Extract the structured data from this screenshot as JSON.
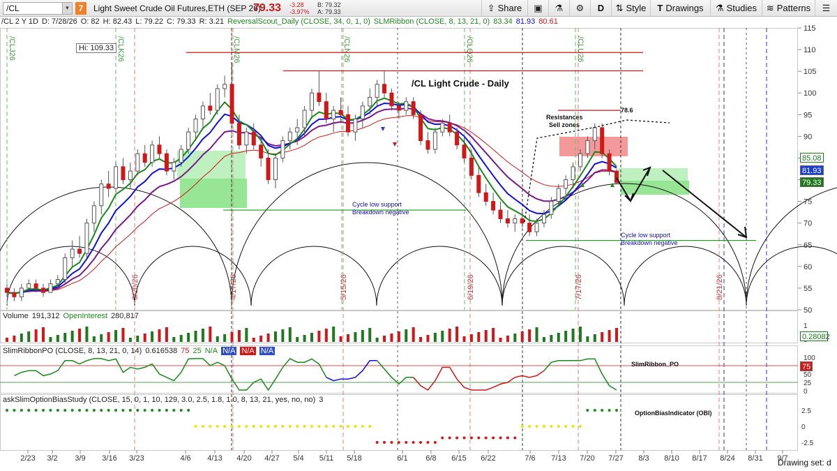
{
  "toolbar": {
    "symbol": "/CL",
    "badge": "7",
    "description": "Light Sweet Crude Oil Futures,ETH (SEP 26)",
    "last": "79.33",
    "change": "-3.28",
    "change_pct": "-3.97%",
    "bid": "B: 79.32",
    "ask": "A: 79.33",
    "share_label": "Share",
    "interval_label": "D",
    "style_label": "Style",
    "drawings_label": "Drawings",
    "studies_label": "Studies",
    "patterns_label": "Patterns"
  },
  "price_header": {
    "symbol": "/CL 2 Y 1D",
    "date": "D: 7/28/26",
    "open": "O: 82",
    "high": "H: 82.43",
    "low": "L: 79.22",
    "close": "C: 79.33",
    "range": "R: 3.21",
    "reversal_scout": "ReversalScout_Daily (CLOSE, 34, 0, 1, 0)",
    "slm_ribbon": "SLMRibbon (CLOSE, 8, 13, 21, 0)",
    "slm_v1": "83.34",
    "slm_v2": "81.93",
    "slm_v3": "80.61"
  },
  "chart_title": "/CL  Light Crude - Daily",
  "high_label": "Hi: 109.33",
  "annotations": {
    "resistance": "Resistances",
    "sell_zones": "Sell zones",
    "level": "78.6",
    "cycle_support_1a": "Cycle low support",
    "cycle_support_1b": "Breakdown negative",
    "cycle_support_2a": "Cycle low support",
    "cycle_support_2b": "Breakdown negative"
  },
  "price_badges": {
    "ema8": "85.08",
    "ema13": "81.93",
    "last": "79.33"
  },
  "volume_header": {
    "label": "Volume",
    "value": "191,312",
    "oi_label": "OpenInterest",
    "oi_value": "280,817",
    "badge": "0.28082"
  },
  "slimribbon_header": {
    "label": "SlimRibbonPO (CLOSE, 8, 13, 21, 0, 14)",
    "v1": "0.616538",
    "v2": "75",
    "v3": "25",
    "na1": "N/A",
    "na2": "N/A",
    "na3": "N/A",
    "na4": "N/A",
    "panel_label": "SlimRibbon_PO",
    "badge": "75"
  },
  "obi_header": {
    "label": "askSlimOptionBiasStudy (CLOSE, 15, 0, 1, 10, 129, 3.0, 2.5, 1.8, 1.0, 8, 13, 21, yes, no, no)",
    "v": "3",
    "panel_label": "OptionBiasIndicator (OBI)"
  },
  "status_bar": "Drawing set: d",
  "colors": {
    "up": "#1f7a1f",
    "down": "#d01818",
    "ema_blue": "#1010e0",
    "ema_green": "#1a8a1a",
    "ema_purple": "#7a1a8a",
    "support_zone": "#8be38b",
    "resist_zone": "#f08080",
    "dots_yellow": "#e8e800"
  },
  "chart_data": {
    "type": "candlestick",
    "price_axis": {
      "ylim": [
        50,
        115
      ],
      "ticks": [
        50,
        55,
        60,
        65,
        70,
        75,
        80,
        85,
        90,
        95,
        100,
        105,
        110,
        115
      ]
    },
    "x_ticks": [
      "2/23",
      "3/2",
      "3/9",
      "3/16",
      "3/23",
      "4/6",
      "4/13",
      "4/20",
      "4/27",
      "5/4",
      "5/11",
      "5/18",
      "6/1",
      "6/8",
      "6/15",
      "6/22",
      "7/6",
      "7/13",
      "7/20",
      "7/27",
      "8/3",
      "8/10",
      "8/17",
      "8/24",
      "8/31",
      "9/7"
    ],
    "cycle_dates": [
      "3/20/26",
      "4/17/26",
      "5/15/26",
      "6/19/26",
      "7/17/26",
      "8/21/26"
    ],
    "contract_labels": [
      "/CLJ26",
      "/CLK26",
      "/CLM26",
      "/CLN26",
      "/CLQ26",
      "/CLU26"
    ],
    "candles": [
      [
        55,
        56,
        53,
        54
      ],
      [
        54,
        55,
        52,
        53
      ],
      [
        53,
        56,
        52,
        55
      ],
      [
        55,
        57,
        54,
        56
      ],
      [
        56,
        57,
        54,
        55
      ],
      [
        55,
        56,
        53,
        54
      ],
      [
        54,
        57,
        54,
        56
      ],
      [
        56,
        58,
        55,
        57
      ],
      [
        57,
        63,
        56,
        62
      ],
      [
        62,
        66,
        60,
        64
      ],
      [
        64,
        67,
        62,
        63
      ],
      [
        63,
        71,
        62,
        70
      ],
      [
        70,
        75,
        68,
        74
      ],
      [
        74,
        80,
        72,
        79
      ],
      [
        79,
        82,
        76,
        78
      ],
      [
        78,
        84,
        77,
        83
      ],
      [
        83,
        85,
        79,
        80
      ],
      [
        80,
        84,
        78,
        82
      ],
      [
        82,
        87,
        81,
        86
      ],
      [
        86,
        88,
        83,
        84
      ],
      [
        84,
        89,
        83,
        88
      ],
      [
        88,
        90,
        85,
        86
      ],
      [
        86,
        87,
        81,
        82
      ],
      [
        82,
        85,
        80,
        84
      ],
      [
        84,
        88,
        83,
        87
      ],
      [
        87,
        92,
        86,
        91
      ],
      [
        91,
        95,
        89,
        94
      ],
      [
        94,
        98,
        92,
        97
      ],
      [
        97,
        100,
        95,
        96
      ],
      [
        96,
        102,
        95,
        101
      ],
      [
        101,
        104,
        99,
        102
      ],
      [
        102,
        107,
        92,
        93
      ],
      [
        93,
        95,
        87,
        88
      ],
      [
        88,
        92,
        86,
        91
      ],
      [
        91,
        93,
        87,
        88
      ],
      [
        88,
        90,
        83,
        85
      ],
      [
        85,
        87,
        79,
        80
      ],
      [
        80,
        86,
        78,
        85
      ],
      [
        85,
        90,
        84,
        89
      ],
      [
        89,
        92,
        87,
        91
      ],
      [
        91,
        94,
        88,
        92
      ],
      [
        92,
        97,
        90,
        96
      ],
      [
        96,
        101,
        94,
        100
      ],
      [
        100,
        105,
        97,
        98
      ],
      [
        98,
        100,
        93,
        94
      ],
      [
        94,
        97,
        91,
        96
      ],
      [
        96,
        99,
        93,
        95
      ],
      [
        95,
        97,
        90,
        91
      ],
      [
        91,
        95,
        89,
        94
      ],
      [
        94,
        98,
        92,
        97
      ],
      [
        97,
        101,
        95,
        99
      ],
      [
        99,
        103,
        97,
        102
      ],
      [
        102,
        105,
        99,
        100
      ],
      [
        100,
        101,
        96,
        97
      ],
      [
        97,
        98,
        94,
        96
      ],
      [
        96,
        99,
        95,
        98
      ],
      [
        98,
        99,
        94,
        95
      ],
      [
        95,
        96,
        88,
        89
      ],
      [
        89,
        91,
        86,
        87
      ],
      [
        87,
        92,
        86,
        91
      ],
      [
        91,
        94,
        90,
        93
      ],
      [
        93,
        95,
        90,
        91
      ],
      [
        91,
        92,
        87,
        88
      ],
      [
        88,
        90,
        84,
        85
      ],
      [
        85,
        87,
        80,
        81
      ],
      [
        81,
        83,
        76,
        77
      ],
      [
        77,
        79,
        74,
        75
      ],
      [
        75,
        77,
        72,
        73
      ],
      [
        73,
        75,
        70,
        71
      ],
      [
        71,
        73,
        69,
        70
      ],
      [
        70,
        72,
        68,
        71
      ],
      [
        71,
        73,
        69,
        70
      ],
      [
        70,
        72,
        67,
        68
      ],
      [
        68,
        71,
        67,
        70
      ],
      [
        70,
        73,
        69,
        72
      ],
      [
        72,
        76,
        71,
        75
      ],
      [
        75,
        79,
        74,
        78
      ],
      [
        78,
        81,
        76,
        80
      ],
      [
        80,
        84,
        78,
        83
      ],
      [
        83,
        87,
        82,
        86
      ],
      [
        86,
        90,
        85,
        89
      ],
      [
        89,
        93,
        87,
        92
      ],
      [
        92,
        93,
        85,
        86
      ],
      [
        86,
        87,
        81,
        82
      ],
      [
        82,
        82.43,
        79.22,
        79.33
      ]
    ],
    "series": [
      {
        "name": "SLMRibbon",
        "values": [
          83.34,
          81.93,
          80.61
        ]
      }
    ],
    "levels": [
      {
        "label": "Hi: 109.33",
        "value": 109.33
      },
      {
        "label": "Cycle low support",
        "value": 73
      },
      {
        "label": "Cycle low support",
        "value": 66
      },
      {
        "label": "78.6",
        "value": 96
      }
    ],
    "volume_axis": {
      "ticks": [
        0,
        1
      ]
    },
    "oscillator_axis": {
      "ticks": [
        0,
        25,
        50,
        75,
        100
      ]
    },
    "obi_axis": {
      "ticks": [
        -2.5,
        0,
        2.5
      ]
    }
  }
}
